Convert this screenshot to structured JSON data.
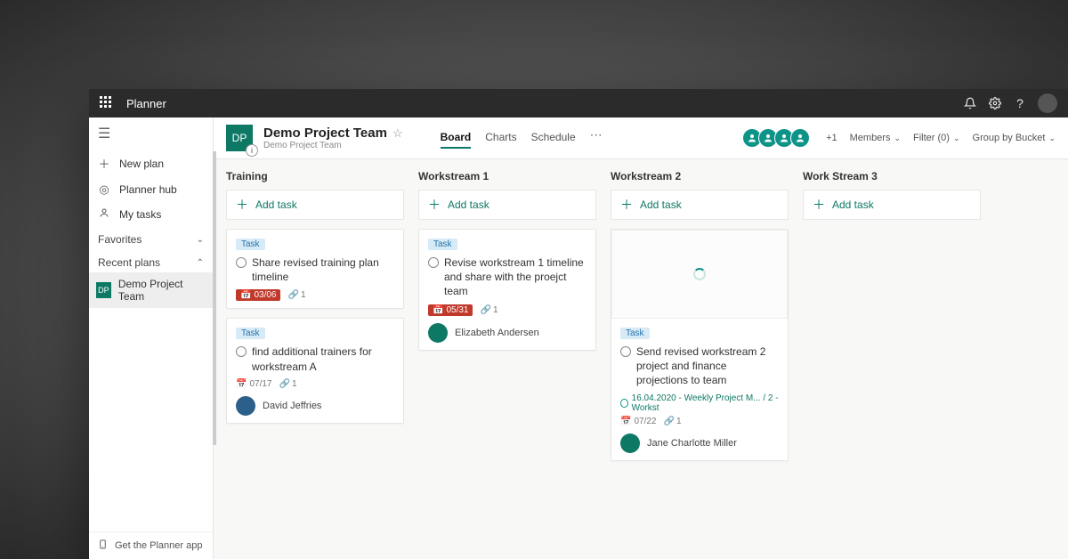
{
  "app": {
    "name": "Planner"
  },
  "titlebar_icons": {
    "bell": "bell-icon",
    "gear": "gear-icon",
    "help": "help-icon"
  },
  "sidebar": {
    "new_plan": "New plan",
    "hub": "Planner hub",
    "my_tasks": "My tasks",
    "favorites_label": "Favorites",
    "recent_label": "Recent plans",
    "recent_item_initials": "DP",
    "recent_item_name": "Demo Project Team",
    "footer": "Get the Planner app"
  },
  "plan": {
    "initials": "DP",
    "title": "Demo Project Team",
    "subtitle": "Demo Project Team",
    "tabs": {
      "board": "Board",
      "charts": "Charts",
      "schedule": "Schedule"
    },
    "plus_members": "+1",
    "members_btn": "Members",
    "filter_btn": "Filter (0)",
    "group_btn": "Group by Bucket"
  },
  "add_task_label": "Add task",
  "task_tag": "Task",
  "buckets": [
    {
      "title": "Training"
    },
    {
      "title": "Workstream 1"
    },
    {
      "title": "Workstream 2"
    },
    {
      "title": "Work Stream 3"
    }
  ],
  "cards": {
    "c1": {
      "title": "Share revised training plan timeline",
      "due": "03/06",
      "attach": "1"
    },
    "c2": {
      "title": "find additional trainers for workstream A",
      "due": "07/17",
      "attach": "1",
      "assignee": "David Jeffries"
    },
    "c3": {
      "title": "Revise workstream 1 timeline and share with the proejct team",
      "due": "05/31",
      "attach": "1",
      "assignee": "Elizabeth Andersen"
    },
    "c4": {
      "title": "Send revised workstream 2 project and finance projections to team",
      "subtask": "16.04.2020 - Weekly Project M... / 2 - Workst",
      "due": "07/22",
      "attach": "1",
      "assignee": "Jane Charlotte Miller"
    }
  },
  "icons": {
    "cal": "📅",
    "clip": "🔗"
  }
}
